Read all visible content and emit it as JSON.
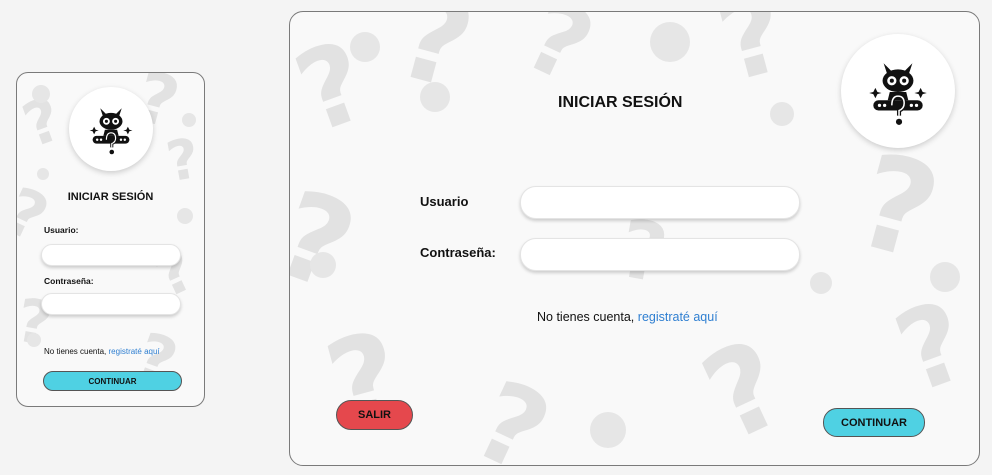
{
  "colors": {
    "background": "#f4f4f4",
    "panel": "#f9f9f9",
    "continue_button": "#4fd1e3",
    "exit_button": "#e5484d",
    "link": "#2f7fd1",
    "pattern": "#e2e2e2"
  },
  "icons": {
    "avatar": "cat-with-glasses-question-mark-icon"
  },
  "mobile": {
    "title": "INICIAR SESIÓN",
    "username_label": "Usuario:",
    "password_label": "Contraseña:",
    "username_value": "",
    "password_value": "",
    "register_prompt": "No tienes cuenta,",
    "register_link": "registraté aquí",
    "continue_label": "CONTINUAR"
  },
  "desktop": {
    "title": "INICIAR SESIÓN",
    "username_label": "Usuario",
    "password_label": "Contraseña:",
    "username_value": "",
    "password_value": "",
    "register_prompt": "No tienes cuenta,",
    "register_link": "registraté aquí",
    "exit_label": "SALIR",
    "continue_label": "CONTINUAR"
  }
}
